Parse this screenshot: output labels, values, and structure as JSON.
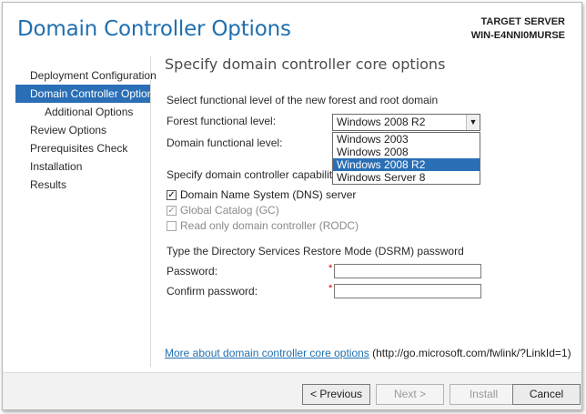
{
  "window": {
    "title": "Domain Controller Options",
    "server_label": "TARGET SERVER",
    "server_name": "WIN-E4NNI0MURSE"
  },
  "sidebar": {
    "items": [
      {
        "label": "Deployment Configuration",
        "active": false
      },
      {
        "label": "Domain Controller Options",
        "active": true
      },
      {
        "label": "Additional Options",
        "active": false
      },
      {
        "label": "Review Options",
        "active": false
      },
      {
        "label": "Prerequisites Check",
        "active": false
      },
      {
        "label": "Installation",
        "active": false
      },
      {
        "label": "Results",
        "active": false
      }
    ]
  },
  "main": {
    "heading": "Specify domain controller core options",
    "functional_level_caption": "Select functional level of the new forest and root domain",
    "forest_level_label": "Forest functional level:",
    "forest_level_value": "Windows 2008 R2",
    "domain_level_label": "Domain functional level:",
    "dropdown_options": [
      "Windows 2003",
      "Windows 2008",
      "Windows 2008 R2",
      "Windows Server 8"
    ],
    "dropdown_selected": "Windows 2008 R2",
    "capabilities_caption": "Specify domain controller capabilities",
    "checkboxes": [
      {
        "label": "Domain Name System (DNS) server",
        "checked": true,
        "enabled": true
      },
      {
        "label": "Global Catalog (GC)",
        "checked": true,
        "enabled": false
      },
      {
        "label": "Read only domain controller (RODC)",
        "checked": false,
        "enabled": false
      }
    ],
    "dsrm_caption": "Type the Directory Services Restore Mode (DSRM) password",
    "password_label": "Password:",
    "confirm_label": "Confirm password:",
    "password_value": "",
    "confirm_value": "",
    "required_mark": "*",
    "more_link": "More about domain controller core options",
    "more_url": "(http://go.microsoft.com/fwlink/?LinkId=1)"
  },
  "footer": {
    "previous": "< Previous",
    "next": "Next >",
    "install": "Install",
    "cancel": "Cancel"
  },
  "colors": {
    "accent": "#2a6fb6",
    "title": "#1f6fb0",
    "required": "#d40000"
  }
}
